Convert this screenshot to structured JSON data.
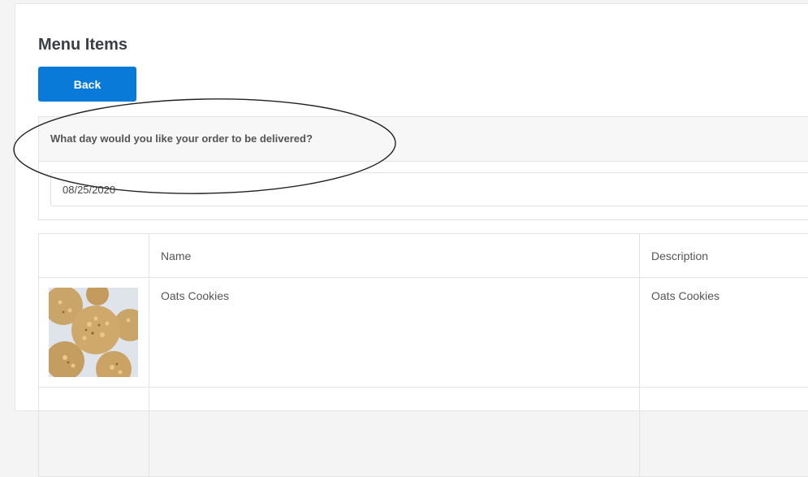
{
  "page": {
    "title": "Menu Items",
    "back_label": "Back"
  },
  "delivery": {
    "question": "What day would you like your order to be delivered?",
    "date_value": "08/25/2020"
  },
  "table": {
    "headers": [
      "",
      "Name",
      "Description"
    ],
    "rows": [
      {
        "image": "cookies-photo",
        "name": "Oats Cookies",
        "description": "Oats Cookies"
      }
    ]
  },
  "colors": {
    "primary_button": "#0a7ad9",
    "page_background": "#f4f4f4",
    "annotation_stroke": "#222222"
  }
}
